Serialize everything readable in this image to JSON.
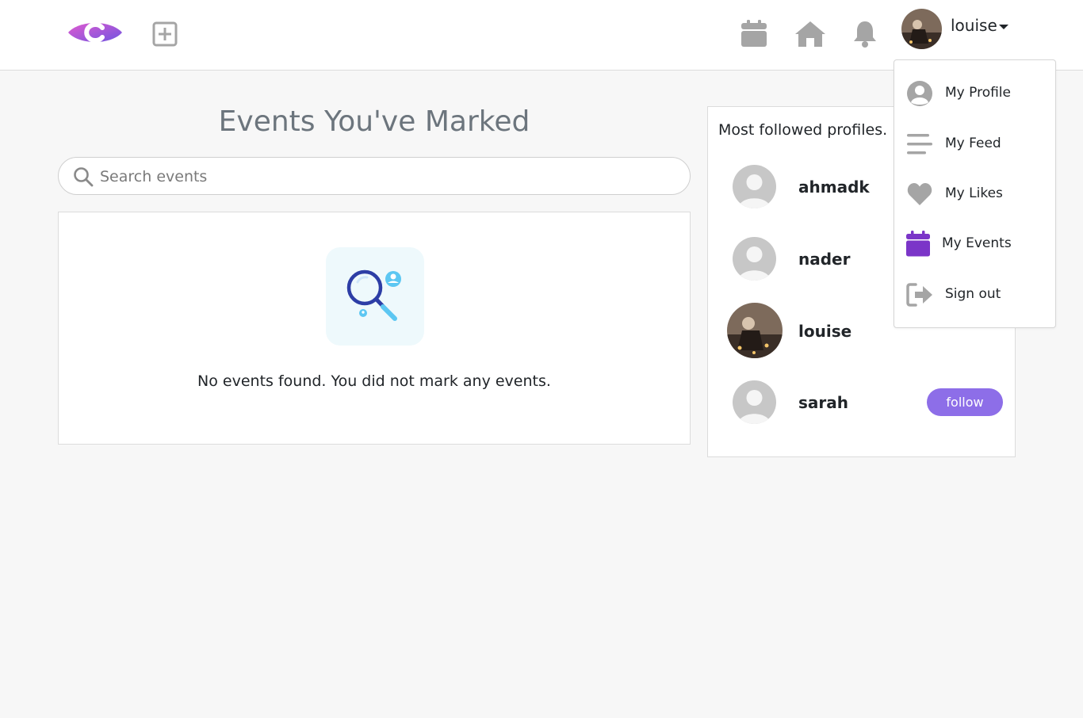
{
  "header": {
    "logo_icon": "brand-logo-eye-c",
    "add_icon": "plus-square-icon",
    "nav_icons": [
      "calendar-icon",
      "home-icon",
      "bell-icon"
    ],
    "user": {
      "name": "louise",
      "avatar_icon": "avatar-photo"
    }
  },
  "main": {
    "title": "Events You've Marked",
    "search": {
      "placeholder": "Search events",
      "value": ""
    },
    "empty_state": {
      "icon": "magnifier-illustration",
      "message": "No events found. You did not mark any events."
    }
  },
  "sidebar": {
    "title": "Most followed profiles.",
    "profiles": [
      {
        "name": "ahmadk",
        "avatar": "default-avatar",
        "action": ""
      },
      {
        "name": "nader",
        "avatar": "default-avatar",
        "action": ""
      },
      {
        "name": "louise",
        "avatar": "avatar-photo",
        "action": ""
      },
      {
        "name": "sarah",
        "avatar": "default-avatar",
        "action": "follow"
      }
    ]
  },
  "dropdown": {
    "items": [
      {
        "label": "My Profile",
        "icon": "user-circle-icon"
      },
      {
        "label": "My Feed",
        "icon": "stream-lines-icon"
      },
      {
        "label": "My Likes",
        "icon": "heart-icon"
      },
      {
        "label": "My Events",
        "icon": "calendar-purple-icon"
      },
      {
        "label": "Sign out",
        "icon": "sign-out-icon"
      }
    ]
  },
  "colors": {
    "accent_purple": "#7b35c8",
    "follow_button": "#8d6ee8",
    "icon_gray": "#a5a5a5",
    "title_gray": "#6c757d"
  }
}
